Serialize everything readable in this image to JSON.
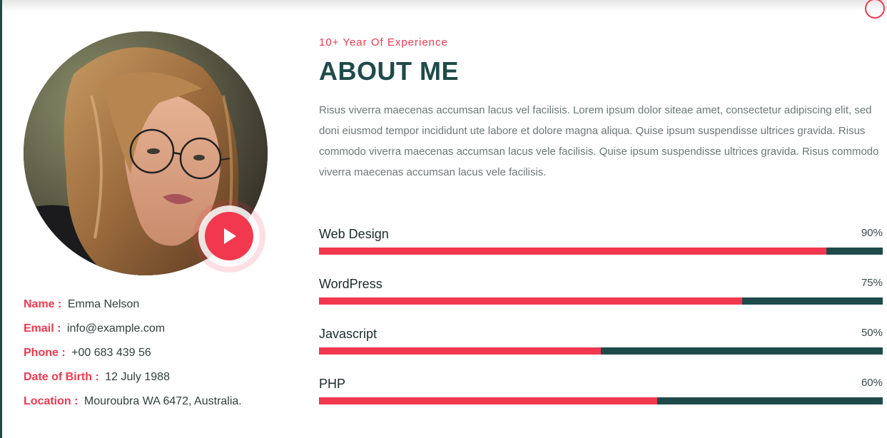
{
  "about": {
    "subtitle": "10+ Year Of Experience",
    "title": "ABOUT ME",
    "description": "Risus viverra maecenas accumsan lacus vel facilisis. Lorem ipsum dolor siteae amet, consectetur adipiscing elit, sed doni eiusmod tempor incididunt ute labore et dolore magna aliqua. Quise ipsum suspendisse ultrices gravida. Risus commodo viverra maecenas accumsan lacus vele facilisis. Quise ipsum suspendisse ultrices gravida. Risus commodo viverra maecenas accumsan lacus vele facilisis."
  },
  "profile": {
    "info": [
      {
        "label": "Name :",
        "value": "Emma Nelson"
      },
      {
        "label": "Email :",
        "value": "info@example.com"
      },
      {
        "label": "Phone :",
        "value": "+00 683 439 56"
      },
      {
        "label": "Date of Birth :",
        "value": "12 July 1988"
      },
      {
        "label": "Location :",
        "value": "Mouroubra WA 6472, Australia."
      }
    ]
  },
  "skills": [
    {
      "name": "Web Design",
      "percent_label": "90%",
      "percent": 90
    },
    {
      "name": "WordPress",
      "percent_label": "75%",
      "percent": 75
    },
    {
      "name": "Javascript",
      "percent_label": "50%",
      "percent": 50
    },
    {
      "name": "PHP",
      "percent_label": "60%",
      "percent": 60
    }
  ],
  "colors": {
    "accent": "#f2384f",
    "dark_teal": "#1f4a4a",
    "body_text": "#6d7777"
  },
  "icons": {
    "play": "play-icon",
    "corner": "circle-outline-icon"
  }
}
